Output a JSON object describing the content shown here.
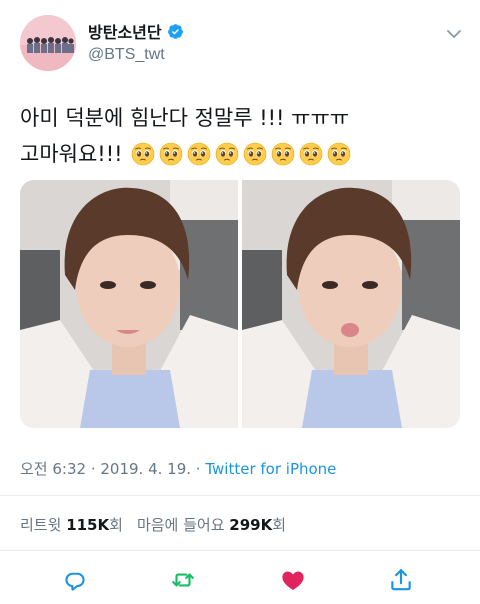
{
  "user": {
    "display_name": "방탄소년단",
    "handle": "@BTS_twt"
  },
  "tweet": {
    "line1": "아미 덕분에 힘난다 정말루 !!! ㅠㅠㅠ",
    "line2": "고마워요!!!",
    "emoji_count": 8
  },
  "meta": {
    "time": "오전 6:32",
    "date": "2019. 4. 19.",
    "separator1": " · ",
    "separator2": " · ",
    "source": "Twitter for iPhone"
  },
  "stats": {
    "retweets_label": "리트윗",
    "retweets_count": "115K",
    "retweets_unit": "회",
    "likes_label": "마음에 들어요",
    "likes_count": "299K",
    "likes_unit": "회"
  },
  "icons": {
    "reply": "reply-icon",
    "retweet": "retweet-icon",
    "like": "heart-icon",
    "share": "share-icon"
  },
  "colors": {
    "verified": "#1da1f2",
    "link": "#1b95e0",
    "retweet": "#17bf63",
    "like": "#e0245e",
    "muted": "#657786"
  }
}
